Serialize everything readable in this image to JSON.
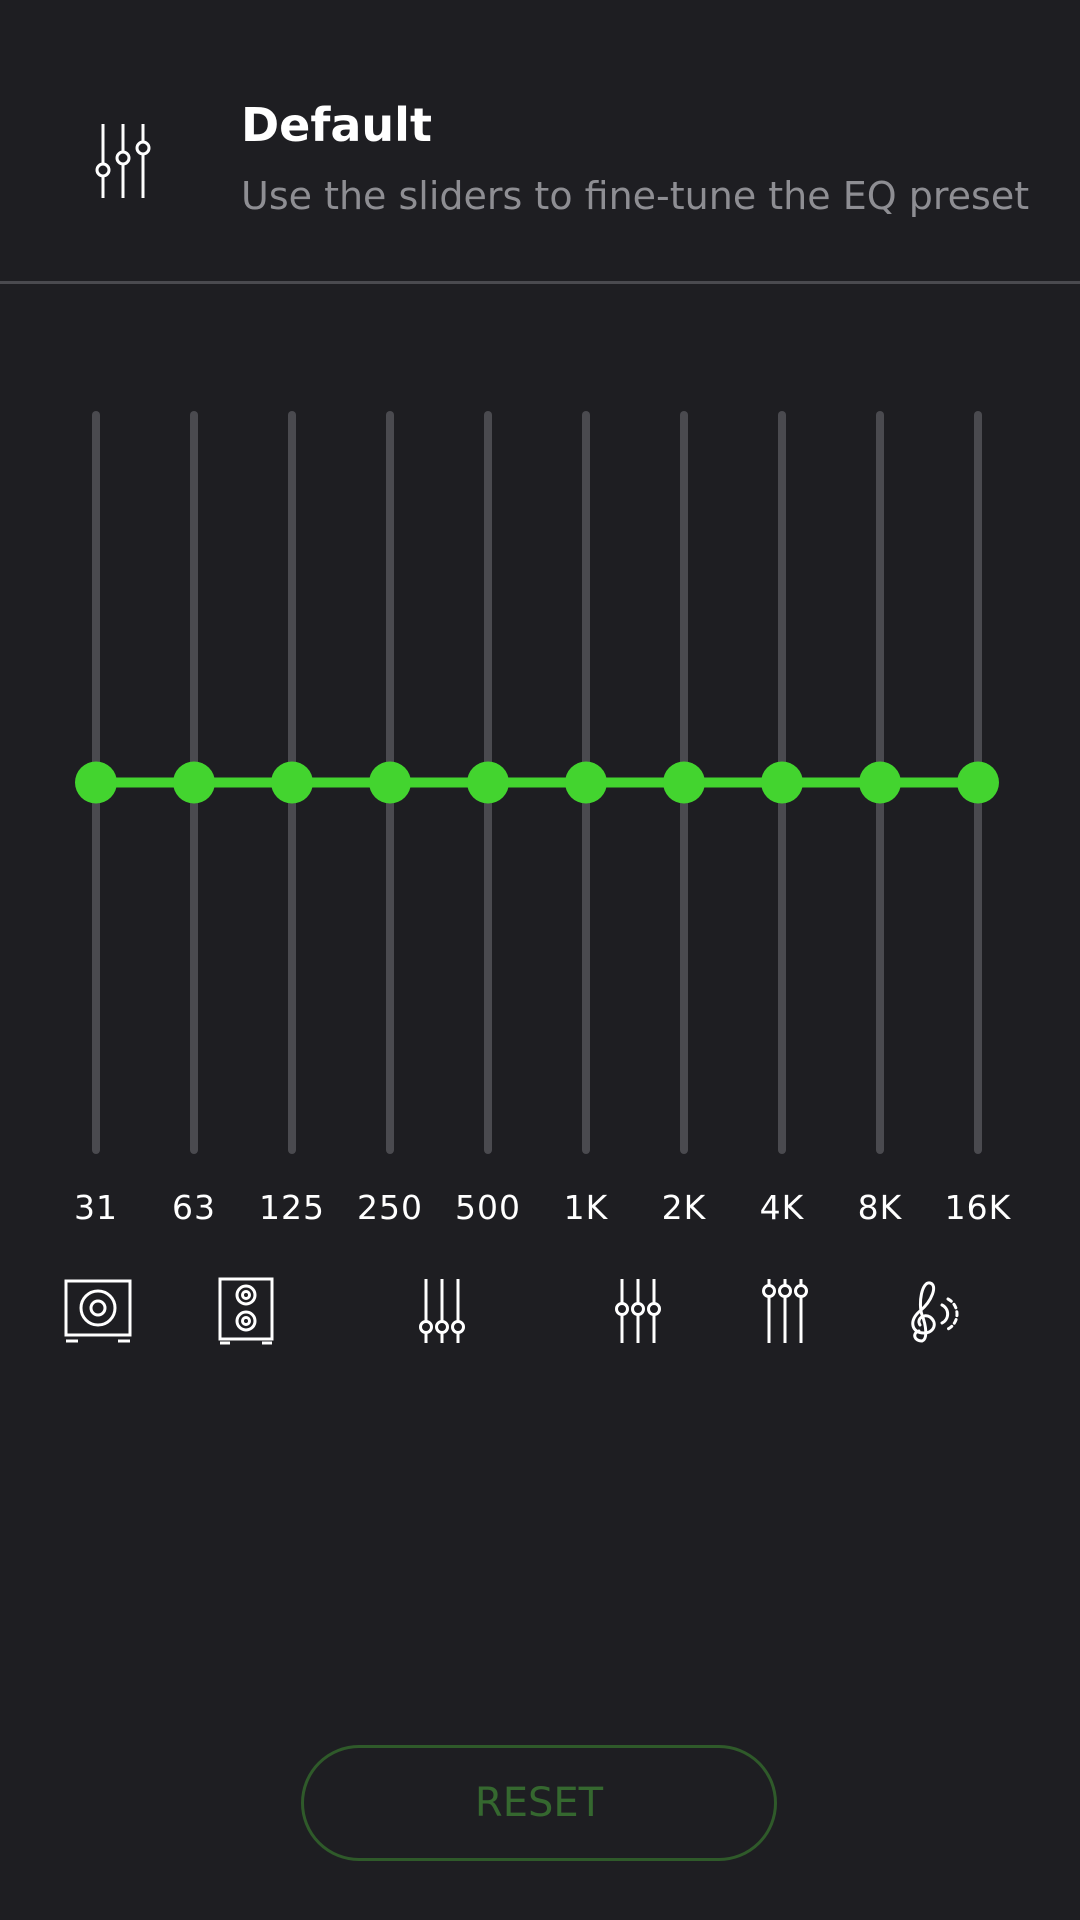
{
  "header": {
    "icon": "equalizer-sliders-icon",
    "preset_name": "Default",
    "description": "Use the sliders to fine-tune the EQ preset"
  },
  "equalizer": {
    "accent_color": "#43d42f",
    "track_color": "#4a4a4f",
    "bands": [
      {
        "label": "31",
        "gain_level": 0.5
      },
      {
        "label": "63",
        "gain_level": 0.5
      },
      {
        "label": "125",
        "gain_level": 0.5
      },
      {
        "label": "250",
        "gain_level": 0.5
      },
      {
        "label": "500",
        "gain_level": 0.5
      },
      {
        "label": "1K",
        "gain_level": 0.5
      },
      {
        "label": "2K",
        "gain_level": 0.5
      },
      {
        "label": "4K",
        "gain_level": 0.5
      },
      {
        "label": "8K",
        "gain_level": 0.5
      },
      {
        "label": "16K",
        "gain_level": 0.5
      }
    ]
  },
  "preset_icons": [
    "subwoofer-icon",
    "speaker-cabinet-icon",
    "equalizer-low-icon",
    "equalizer-mid-icon",
    "equalizer-high-icon",
    "treble-clef-icon"
  ],
  "reset": {
    "label": "RESET",
    "color": "#35682f"
  }
}
